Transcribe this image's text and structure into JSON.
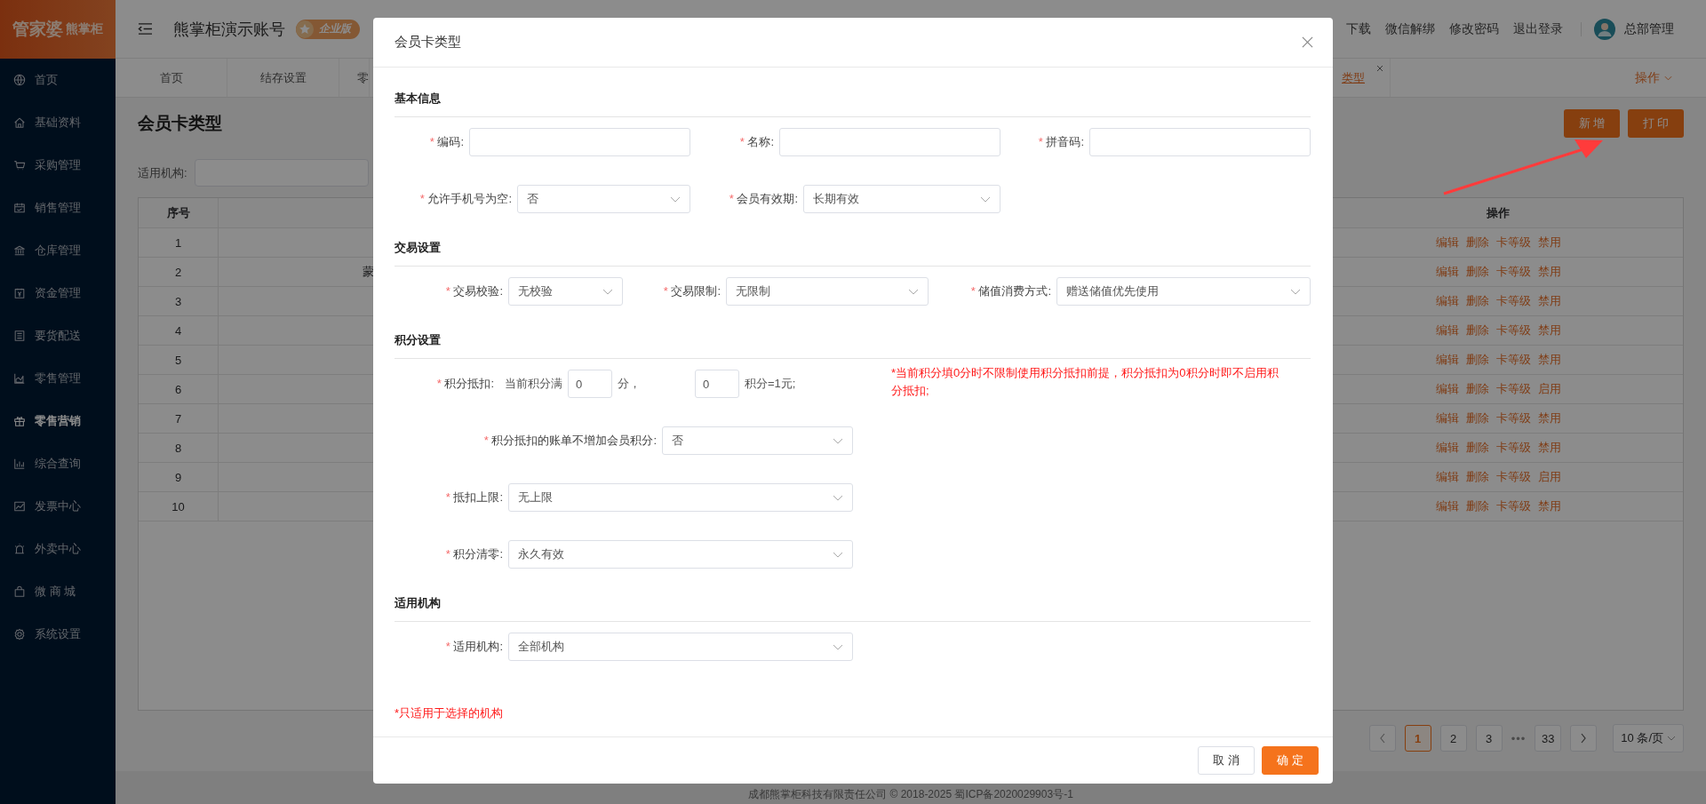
{
  "sidebar": {
    "logo": {
      "main": "管家婆",
      "sub": "熊掌柜"
    },
    "items": [
      {
        "label": "首页",
        "selected": false
      },
      {
        "label": "基础资料",
        "selected": false
      },
      {
        "label": "采购管理",
        "selected": false
      },
      {
        "label": "销售管理",
        "selected": false
      },
      {
        "label": "仓库管理",
        "selected": false
      },
      {
        "label": "资金管理",
        "selected": false
      },
      {
        "label": "要货配送",
        "selected": false
      },
      {
        "label": "零售管理",
        "selected": false
      },
      {
        "label": "零售营销",
        "selected": true
      },
      {
        "label": "综合查询",
        "selected": false
      },
      {
        "label": "发票中心",
        "selected": false
      },
      {
        "label": "外卖中心",
        "selected": false
      },
      {
        "label": "微 商 城",
        "selected": false
      },
      {
        "label": "系统设置",
        "selected": false
      }
    ]
  },
  "header": {
    "title": "熊掌柜演示账号",
    "badge": "企业版",
    "links": [
      "下载",
      "微信解绑",
      "修改密码",
      "退出登录"
    ],
    "user": "总部管理"
  },
  "tabs": [
    {
      "label": "首页",
      "selected": false
    },
    {
      "label": "结存设置",
      "selected": false
    },
    {
      "label": "零",
      "selected": false
    },
    {
      "label": "类型",
      "selected": true
    }
  ],
  "tab_menu": "操作",
  "page": {
    "title": "会员卡类型",
    "buttons": [
      "新 增",
      "打 印"
    ],
    "filter_label": "适用机构:"
  },
  "table": {
    "columns": [
      "序号",
      "操作"
    ],
    "rows": [
      {
        "no": "1",
        "actions": [
          "编辑",
          "删除",
          "卡等级",
          "禁用"
        ]
      },
      {
        "no": "2",
        "column_2": "蒙",
        "actions": [
          "编辑",
          "删除",
          "卡等级",
          "禁用"
        ]
      },
      {
        "no": "3",
        "actions": [
          "编辑",
          "删除",
          "卡等级",
          "禁用"
        ]
      },
      {
        "no": "4",
        "actions": [
          "编辑",
          "删除",
          "卡等级",
          "禁用"
        ]
      },
      {
        "no": "5",
        "actions": [
          "编辑",
          "删除",
          "卡等级",
          "禁用"
        ]
      },
      {
        "no": "6",
        "actions": [
          "编辑",
          "删除",
          "卡等级",
          "启用"
        ]
      },
      {
        "no": "7",
        "actions": [
          "编辑",
          "删除",
          "卡等级",
          "禁用"
        ]
      },
      {
        "no": "8",
        "actions": [
          "编辑",
          "删除",
          "卡等级",
          "禁用"
        ]
      },
      {
        "no": "9",
        "actions": [
          "编辑",
          "删除",
          "卡等级",
          "启用"
        ]
      },
      {
        "no": "10",
        "actions": [
          "编辑",
          "删除",
          "卡等级",
          "禁用"
        ]
      }
    ]
  },
  "pagination": {
    "pages": [
      {
        "label": "1",
        "kind": "page",
        "selected": true
      },
      {
        "label": "2",
        "kind": "page",
        "selected": false
      },
      {
        "label": "3",
        "kind": "page",
        "selected": false
      },
      {
        "label": "•••",
        "kind": "ellipsis",
        "selected": false
      },
      {
        "label": "33",
        "kind": "page",
        "selected": false
      }
    ],
    "page_size": "10 条/页"
  },
  "footer": "成都熊掌柜科技有限责任公司 © 2018-2025 蜀ICP备2020029903号-1",
  "modal": {
    "title": "会员卡类型",
    "sections": [
      {
        "title": "基本信息",
        "rows": [
          {
            "kind": "fields",
            "fields": [
              {
                "mark": "*",
                "label": "编码:",
                "kind": "input"
              },
              {
                "mark": "*",
                "label": "名称:",
                "kind": "input"
              },
              {
                "mark": "*",
                "label": "拼音码:",
                "kind": "input"
              }
            ]
          },
          {
            "kind": "fields",
            "fields": [
              {
                "mark": "*",
                "label": "允许手机号为空:",
                "kind": "select",
                "value": "否"
              },
              {
                "mark": "*",
                "label": "会员有效期:",
                "kind": "select",
                "value": "长期有效"
              }
            ]
          }
        ]
      },
      {
        "title": "交易设置",
        "rows": [
          {
            "kind": "fields",
            "fields": [
              {
                "mark": "*",
                "label": "交易校验:",
                "kind": "select",
                "value": "无校验"
              },
              {
                "mark": "*",
                "label": "交易限制:",
                "kind": "select",
                "value": "无限制"
              },
              {
                "mark": "*",
                "label": "储值消费方式:",
                "kind": "select",
                "value": "赠送储值优先使用"
              }
            ]
          }
        ]
      },
      {
        "title": "积分设置",
        "rows": [
          {
            "kind": "points",
            "mark": "*",
            "label": "积分抵扣:",
            "prefix": "当前积分满",
            "first_value": "0",
            "middle": "分，",
            "second_value": "0",
            "suffix": "积分=1元;",
            "note": "*当前积分填0分时不限制使用积分抵扣前提，积分抵扣为0积分时即不启用积分抵扣;"
          },
          {
            "kind": "fields",
            "fields": [
              {
                "mark": "*",
                "label": "积分抵扣的账单不增加会员积分:",
                "kind": "select",
                "value": "否"
              }
            ]
          },
          {
            "kind": "fields",
            "fields": [
              {
                "mark": "*",
                "label": "抵扣上限:",
                "kind": "select",
                "value": "无上限"
              }
            ]
          },
          {
            "kind": "fields",
            "fields": [
              {
                "mark": "*",
                "label": "积分清零:",
                "kind": "select",
                "value": "永久有效"
              }
            ]
          }
        ]
      },
      {
        "title": "适用机构",
        "rows": [
          {
            "kind": "fields",
            "fields": [
              {
                "mark": "*",
                "label": "适用机构:",
                "kind": "select",
                "value": "全部机构"
              }
            ]
          }
        ]
      }
    ],
    "note": "*只适用于选择的机构",
    "buttons": [
      {
        "label": "取 消",
        "kind": "default"
      },
      {
        "label": "确 定",
        "kind": "primary"
      }
    ]
  }
}
